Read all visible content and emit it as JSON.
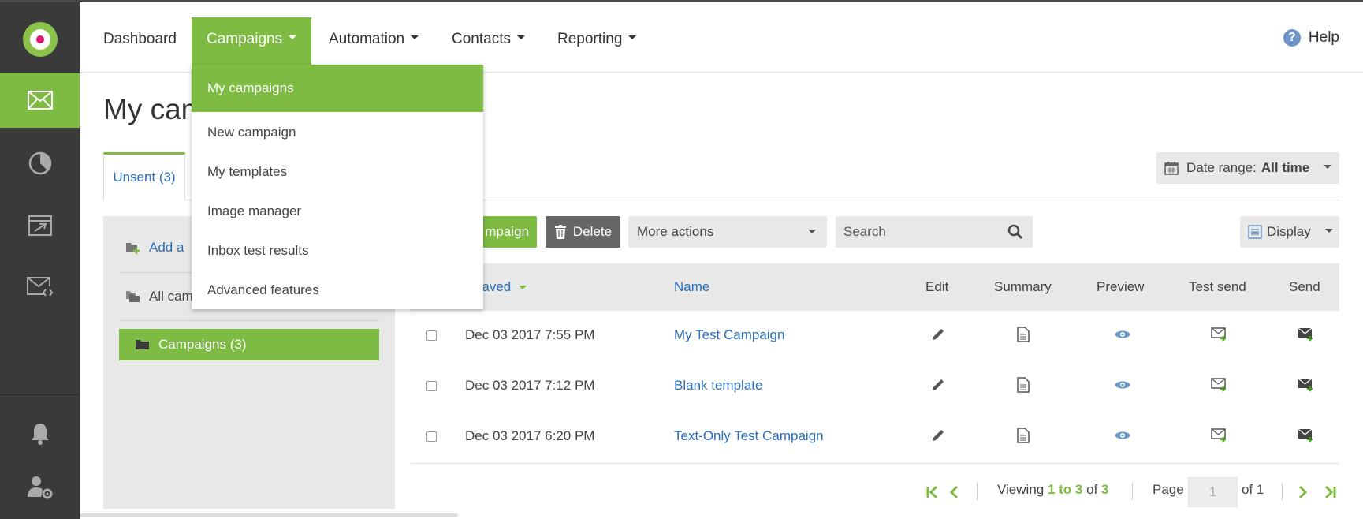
{
  "nav": {
    "items": [
      {
        "label": "Dashboard",
        "has_caret": false
      },
      {
        "label": "Campaigns",
        "has_caret": true
      },
      {
        "label": "Automation",
        "has_caret": true
      },
      {
        "label": "Contacts",
        "has_caret": true
      },
      {
        "label": "Reporting",
        "has_caret": true
      }
    ],
    "help_label": "Help"
  },
  "rail": {
    "items": [
      "email-icon",
      "chart-pie-icon",
      "automation-icon",
      "email-code-icon",
      "bell-icon",
      "user-settings-icon"
    ],
    "active": "email-icon"
  },
  "page": {
    "title": "My cam",
    "tab_unsent": "Unsent (3)",
    "date_range_label": "Date range:",
    "date_range_value": "All time"
  },
  "left_panel": {
    "add_label": "Add a",
    "all_label": "All cam",
    "campaigns_label": "Campaigns (3)"
  },
  "toolbar": {
    "new_campaign_label": "mpaign",
    "delete_label": "Delete",
    "more_actions_label": "More actions",
    "search_placeholder": "Search",
    "display_label": "Display"
  },
  "table": {
    "headers": {
      "date": "te saved",
      "name": "Name",
      "edit": "Edit",
      "summary": "Summary",
      "preview": "Preview",
      "test_send": "Test send",
      "send": "Send"
    },
    "rows": [
      {
        "date": "Dec 03 2017 7:55 PM",
        "name": "My Test Campaign"
      },
      {
        "date": "Dec 03 2017 7:12 PM",
        "name": "Blank template"
      },
      {
        "date": "Dec 03 2017 6:20 PM",
        "name": "Text-Only Test Campaign"
      }
    ]
  },
  "pagination": {
    "viewing_prefix": "Viewing",
    "range": "1 to 3",
    "of_word": "of",
    "total": "3",
    "page_label": "Page",
    "page_value": "1",
    "of_pages": "of 1"
  },
  "dropdown": {
    "items": [
      "My campaigns",
      "New campaign",
      "My templates",
      "Image manager",
      "Inbox test results",
      "Advanced features"
    ],
    "active_index": 0
  },
  "colors": {
    "accent_green": "#7dbb42",
    "rail_bg": "#3a3a3a",
    "link_blue": "#2a6ebb",
    "logo_pink": "#e0157a"
  }
}
